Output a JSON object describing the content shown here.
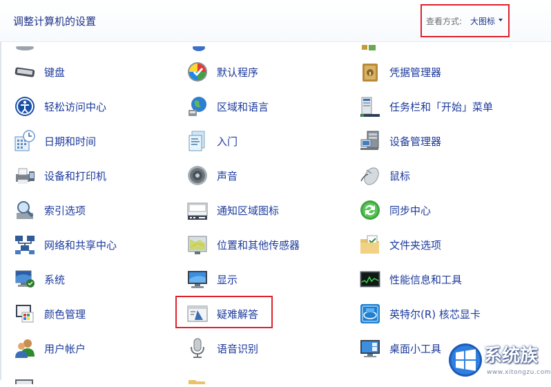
{
  "header": {
    "title": "调整计算机的设置",
    "view_label": "查看方式:",
    "view_value": "大图标"
  },
  "items": [
    {
      "label": "键盘",
      "icon": "keyboard-icon"
    },
    {
      "label": "默认程序",
      "icon": "default-programs-icon"
    },
    {
      "label": "凭据管理器",
      "icon": "credential-manager-icon"
    },
    {
      "label": "轻松访问中心",
      "icon": "ease-of-access-icon"
    },
    {
      "label": "区域和语言",
      "icon": "region-language-icon"
    },
    {
      "label": "任务栏和「开始」菜单",
      "icon": "taskbar-start-menu-icon"
    },
    {
      "label": "日期和时间",
      "icon": "date-time-icon"
    },
    {
      "label": "入门",
      "icon": "getting-started-icon"
    },
    {
      "label": "设备管理器",
      "icon": "device-manager-icon"
    },
    {
      "label": "设备和打印机",
      "icon": "devices-printers-icon"
    },
    {
      "label": "声音",
      "icon": "sound-icon"
    },
    {
      "label": "鼠标",
      "icon": "mouse-icon"
    },
    {
      "label": "索引选项",
      "icon": "indexing-options-icon"
    },
    {
      "label": "通知区域图标",
      "icon": "notification-area-icon"
    },
    {
      "label": "同步中心",
      "icon": "sync-center-icon"
    },
    {
      "label": "网络和共享中心",
      "icon": "network-sharing-icon"
    },
    {
      "label": "位置和其他传感器",
      "icon": "location-sensors-icon"
    },
    {
      "label": "文件夹选项",
      "icon": "folder-options-icon"
    },
    {
      "label": "系统",
      "icon": "system-icon"
    },
    {
      "label": "显示",
      "icon": "display-icon"
    },
    {
      "label": "性能信息和工具",
      "icon": "performance-icon"
    },
    {
      "label": "颜色管理",
      "icon": "color-management-icon"
    },
    {
      "label": "疑难解答",
      "icon": "troubleshooting-icon"
    },
    {
      "label": "英特尔(R) 核芯显卡",
      "icon": "intel-graphics-icon"
    },
    {
      "label": "用户帐户",
      "icon": "user-accounts-icon"
    },
    {
      "label": "语音识别",
      "icon": "speech-recognition-icon"
    },
    {
      "label": "桌面小工具",
      "icon": "desktop-gadgets-icon"
    }
  ],
  "watermark": {
    "brand": "系统族",
    "url": "www.xitongzu.com"
  }
}
